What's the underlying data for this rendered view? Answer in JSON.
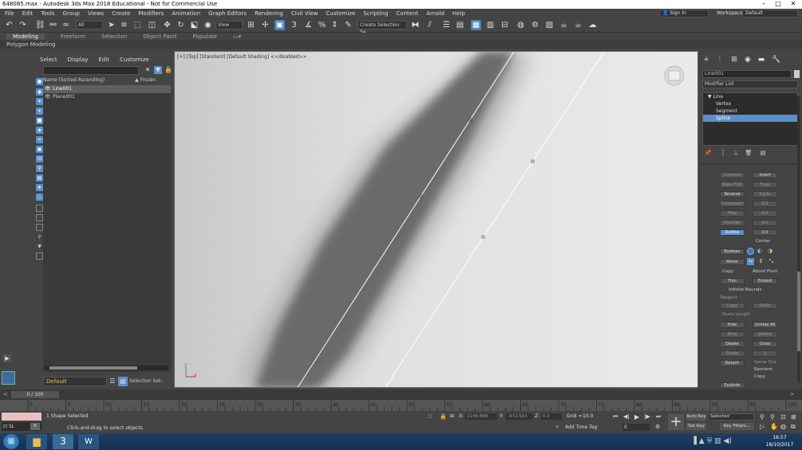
{
  "window": {
    "title": "648085.max - Autodesk 3ds Max 2018 Educational - Not for Commercial Use",
    "min_glyph": "–",
    "max_glyph": "□",
    "close_glyph": "✕"
  },
  "menu": [
    "File",
    "Edit",
    "Tools",
    "Group",
    "Views",
    "Create",
    "Modifiers",
    "Animation",
    "Graph Editors",
    "Rendering",
    "Civil View",
    "Customize",
    "Scripting",
    "Content",
    "Arnold",
    "Help"
  ],
  "account": {
    "sign_in": "Sign In",
    "workspaces_label": "Workspaces:",
    "workspace_value": "Default"
  },
  "toolbar": {
    "selection_filter": "All",
    "view_ref": "View",
    "selection_set": "Create Selection Se"
  },
  "ribbon": {
    "tabs": [
      "Modeling",
      "Freeform",
      "Selection",
      "Object Paint",
      "Populate"
    ],
    "sub": "Polygon Modeling"
  },
  "scene": {
    "menu": [
      "Select",
      "Display",
      "Edit",
      "Customize"
    ],
    "col_name": "Name (Sorted Ascending)",
    "col_frozen": "▲ Frozen",
    "items": [
      {
        "name": "Line001",
        "selected": true
      },
      {
        "name": "Plane001",
        "selected": false
      }
    ],
    "layer": "Default",
    "selection_set_label": "Selection Set:"
  },
  "viewport": {
    "label": "[+] [Top] [Standard] [Default Shading] <<disabled>>",
    "axis_y": "y",
    "axis_x": "x"
  },
  "command": {
    "object_name": "Line001",
    "modifier_list": "Modifier List",
    "stack": [
      {
        "label": "▼ Line",
        "sel": false
      },
      {
        "label": "Vertex",
        "sel": false
      },
      {
        "label": "Segment",
        "sel": false
      },
      {
        "label": "Spline",
        "sel": true
      }
    ],
    "buttons": {
      "connect": "Connect",
      "insert": "Insert",
      "refine": "Make First",
      "fuse": "Fuse",
      "reverse": "Reverse",
      "cycle": "Cycle",
      "crossinsert": "CrossInsert",
      "fillet": "Fillet",
      "chamfer": "Chamfer",
      "outline": "Outline",
      "boolean": "Boolean",
      "mirror": "Mirror",
      "trim": "Trim",
      "extend": "Extend",
      "hide": "Hide",
      "unhide_all": "Unhide All",
      "bind": "Bind",
      "unbind": "Unbind",
      "delete": "Delete",
      "close": "Close",
      "divide": "Divide",
      "detach": "Detach",
      "explode": "Explode",
      "copy_t": "Copy",
      "paste_t": "Paste"
    },
    "labels": {
      "center": "Center",
      "copy": "Copy",
      "about_pivot": "About Pivot",
      "infinite": "Infinite Bounds",
      "tangent": "Tangent",
      "paste_length": "Paste Length",
      "same_shp": "Same Shp",
      "reorient": "Reorient",
      "copy2": "Copy",
      "zero": "0.0",
      "one": "1"
    }
  },
  "time": {
    "frame": "0 / 100",
    "ticks": [
      "0",
      "5",
      "10",
      "15",
      "20",
      "25",
      "30",
      "35",
      "40",
      "45",
      "50",
      "55",
      "60",
      "65",
      "70",
      "75",
      "80",
      "85",
      "90",
      "95",
      "100"
    ]
  },
  "status": {
    "maxscript": "",
    "selected": "1 Shape Selected",
    "prompt": "Click-and-drag to select objects",
    "x_label": "X:",
    "x_value": "2248.868",
    "y_label": "Y:",
    "y_value": "-972.563",
    "z_label": "Z:",
    "z_value": "0.0",
    "grid_label": "Grid =",
    "grid_value": "10.0",
    "add_time_tag": "Add Time Tag",
    "auto_key": "Auto Key",
    "set_key": "Set Key",
    "selected_drop": "Selected",
    "key_filters": "Key Filters...",
    "frame_value": "0"
  },
  "taskbar": {
    "time": "16:57",
    "date": "18/10/2017"
  }
}
